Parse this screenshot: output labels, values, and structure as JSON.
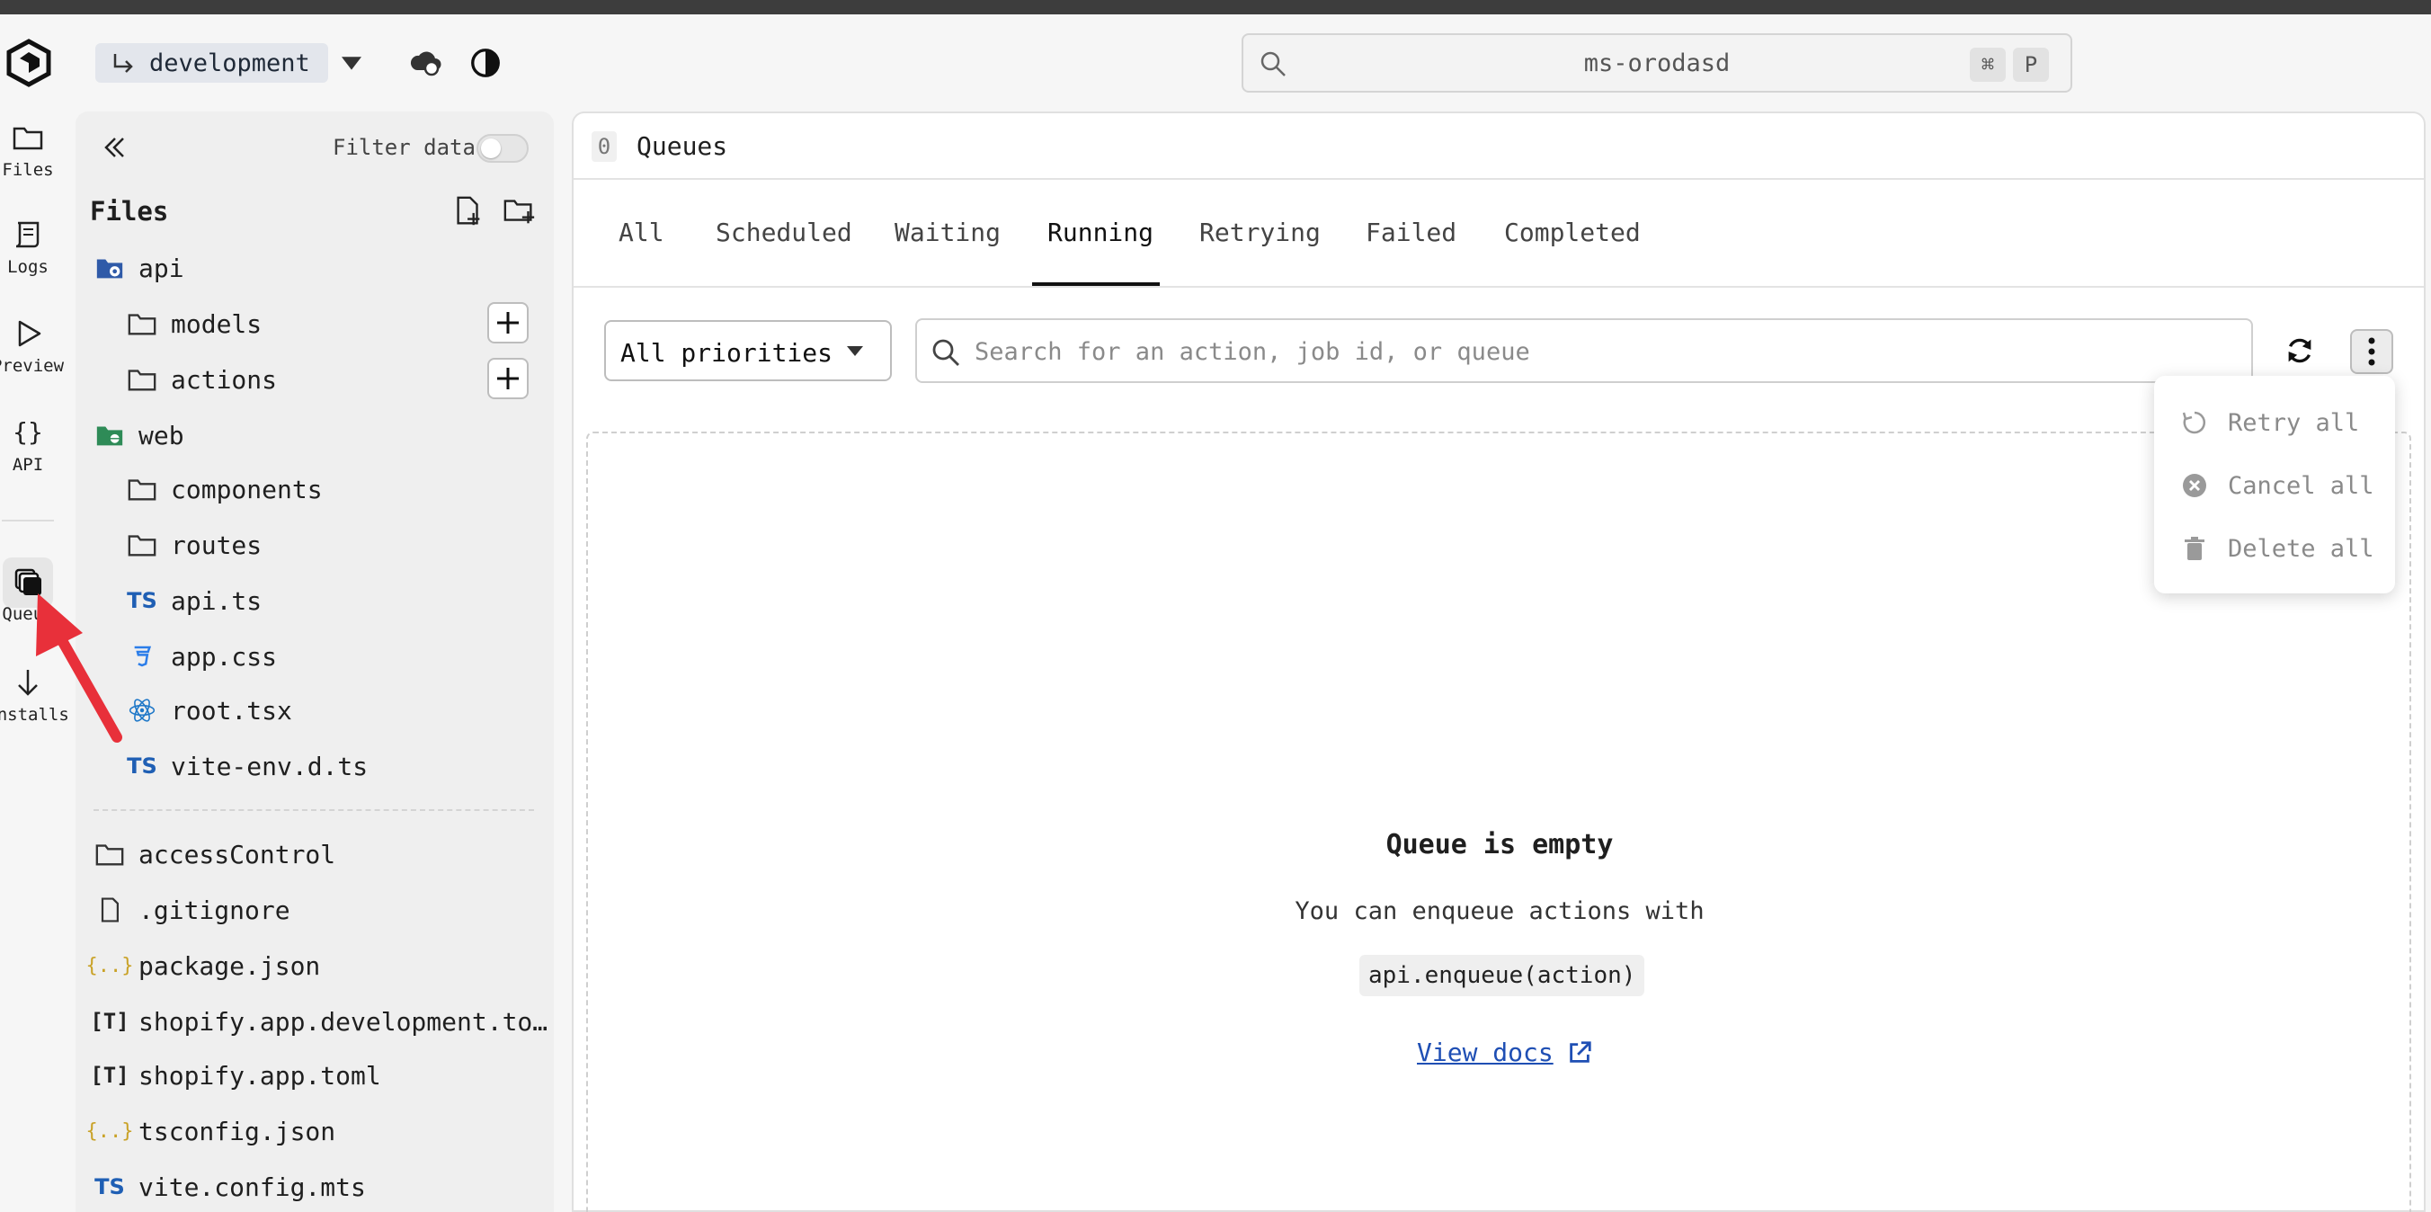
{
  "header": {
    "branch": "development",
    "search_value": "ms-orodasd",
    "shortcut_keys": [
      "⌘",
      "P"
    ]
  },
  "rail": [
    {
      "label": "Files",
      "icon": "folder-icon"
    },
    {
      "label": "Logs",
      "icon": "scroll-icon"
    },
    {
      "label": "Preview",
      "icon": "play-icon"
    },
    {
      "label": "API",
      "icon": "braces-icon"
    },
    {
      "label": "Queue",
      "icon": "queue-stack-icon"
    },
    {
      "label": "Installs",
      "icon": "arrow-down-icon"
    }
  ],
  "filepanel": {
    "filter_label": "Filter data",
    "title": "Files",
    "tree": [
      {
        "name": "api",
        "icon": "folder-gear-icon"
      },
      {
        "name": "models",
        "icon": "folder-icon"
      },
      {
        "name": "actions",
        "icon": "folder-icon"
      },
      {
        "name": "web",
        "icon": "folder-globe-icon"
      },
      {
        "name": "components",
        "icon": "folder-icon"
      },
      {
        "name": "routes",
        "icon": "folder-icon"
      },
      {
        "name": "api.ts",
        "icon": "typescript-icon"
      },
      {
        "name": "app.css",
        "icon": "css-icon"
      },
      {
        "name": "root.tsx",
        "icon": "react-icon"
      },
      {
        "name": "vite-env.d.ts",
        "icon": "typescript-icon"
      }
    ],
    "root_files": [
      {
        "name": "accessControl",
        "icon": "folder-icon"
      },
      {
        "name": ".gitignore",
        "icon": "file-icon"
      },
      {
        "name": "package.json",
        "icon": "json-icon"
      },
      {
        "name": "shopify.app.development.to…",
        "icon": "toml-icon"
      },
      {
        "name": "shopify.app.toml",
        "icon": "toml-icon"
      },
      {
        "name": "tsconfig.json",
        "icon": "json-icon"
      },
      {
        "name": "vite.config.mts",
        "icon": "typescript-icon"
      }
    ]
  },
  "main": {
    "count": "0",
    "title": "Queues",
    "tabs": [
      "All",
      "Scheduled",
      "Waiting",
      "Running",
      "Retrying",
      "Failed",
      "Completed"
    ],
    "active_tab": "Running",
    "priority_select": "All priorities",
    "search_placeholder": "Search for an action, job id, or queue",
    "search_value": "",
    "empty_title": "Queue is empty",
    "empty_subtitle": "You can enqueue actions with",
    "empty_code": "api.enqueue(action)",
    "docs_link": "View docs"
  },
  "menu": {
    "items": [
      {
        "label": "Retry all",
        "icon": "retry-icon"
      },
      {
        "label": "Cancel all",
        "icon": "cancel-circle-icon"
      },
      {
        "label": "Delete all",
        "icon": "trash-icon"
      }
    ]
  },
  "colors": {
    "accent_link": "#1f4fb4",
    "annotation_arrow": "#e8303a"
  }
}
